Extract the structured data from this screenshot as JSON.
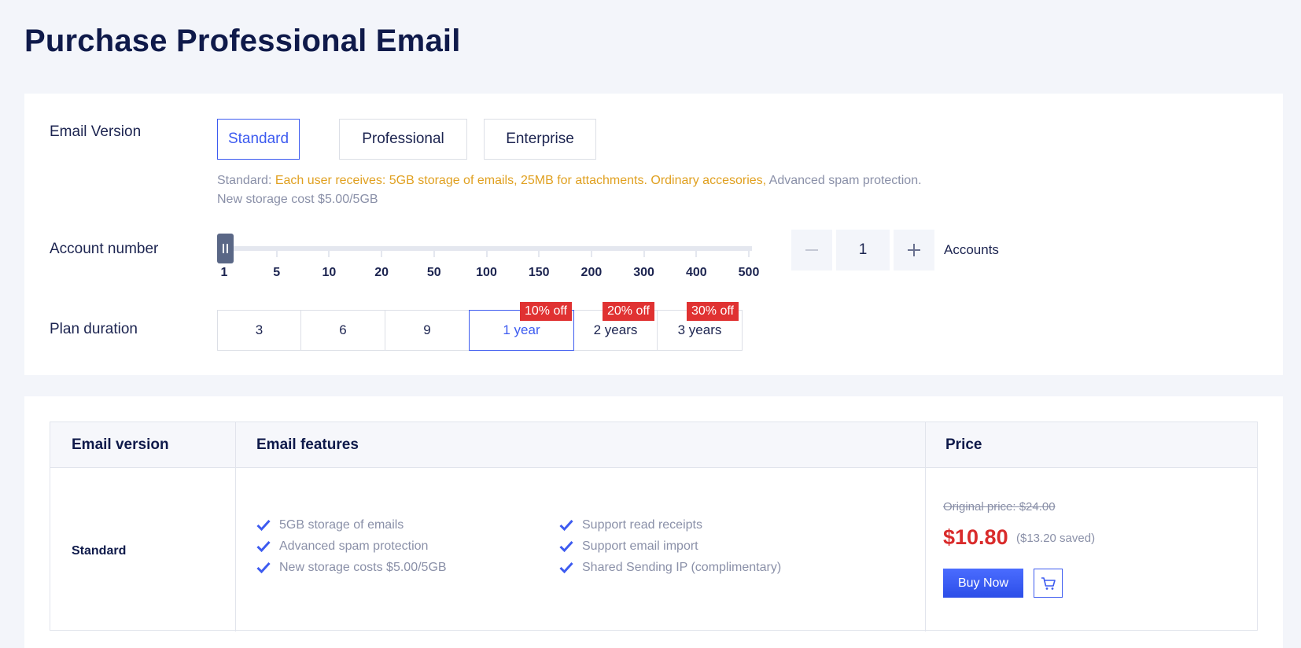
{
  "page": {
    "title": "Purchase Professional Email"
  },
  "email_version": {
    "label": "Email Version",
    "options": [
      "Standard",
      "Professional",
      "Enterprise"
    ],
    "selected": "Standard",
    "desc_prefix": "Standard: ",
    "desc_highlight": "Each user receives: 5GB storage of emails, 25MB for attachments. Ordinary accesories,",
    "desc_suffix": " Advanced spam protection.",
    "storage_note": "New storage cost $5.00/5GB"
  },
  "account_number": {
    "label": "Account number",
    "ticks": [
      "1",
      "5",
      "10",
      "20",
      "50",
      "100",
      "150",
      "200",
      "300",
      "400",
      "500"
    ],
    "slider_value": "1",
    "stepper_value": "1",
    "unit_label": "Accounts"
  },
  "plan_duration": {
    "label": "Plan duration",
    "options": [
      "3",
      "6",
      "9",
      "1 year",
      "2 years",
      "3 years"
    ],
    "selected": "1 year",
    "discounts": [
      "10% off",
      "20% off",
      "30% off"
    ]
  },
  "table": {
    "headers": [
      "Email version",
      "Email features",
      "Price"
    ],
    "row": {
      "version": "Standard",
      "features_left": [
        "5GB storage of emails",
        "Advanced spam protection",
        "New storage costs $5.00/5GB"
      ],
      "features_right": [
        "Support read receipts",
        "Support email import",
        "Shared Sending IP (complimentary)"
      ],
      "original_price": "Original price: $24.00",
      "price": "$10.80",
      "saved": "($13.20 saved)",
      "buy_label": "Buy Now"
    }
  },
  "icons": {
    "minus": "minus-icon",
    "plus": "plus-icon",
    "check": "check-icon",
    "cart": "cart-icon"
  },
  "colors": {
    "accent": "#3d5bf0",
    "discount": "#e03232",
    "price": "#d92b2b",
    "highlight": "#e0a020"
  }
}
